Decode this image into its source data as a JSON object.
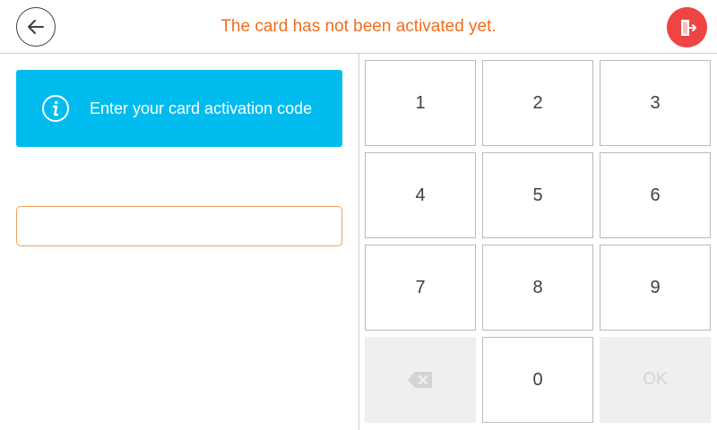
{
  "header": {
    "title": "The card has not been activated yet.",
    "back_icon": "arrow-left-icon",
    "exit_icon": "exit-door-icon",
    "accent_color": "#f26c1d",
    "exit_color": "#ef4444"
  },
  "info_banner": {
    "icon": "info-icon",
    "text": "Enter your card activation code",
    "color": "#00bcee"
  },
  "code_input": {
    "value": "",
    "placeholder": ""
  },
  "keypad": {
    "keys": [
      "1",
      "2",
      "3",
      "4",
      "5",
      "6",
      "7",
      "8",
      "9"
    ],
    "zero": "0",
    "backspace_icon": "backspace-icon",
    "ok_label": "OK",
    "backspace_enabled": false,
    "ok_enabled": false
  }
}
